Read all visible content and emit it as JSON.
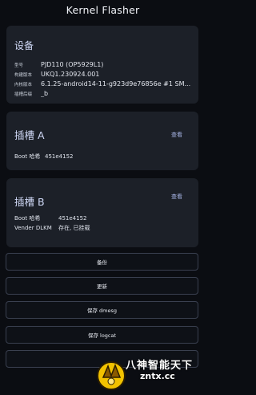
{
  "appbar": {
    "title": "Kernel Flasher"
  },
  "device": {
    "title": "设备",
    "rows": [
      {
        "label": "型号",
        "value": "PJD110 (OP5929L1)"
      },
      {
        "label": "构建版本",
        "value": "UKQ1.230924.001"
      },
      {
        "label": "内核版本",
        "value": "6.1.25-android14-11-g923d9e76856e #1 SM..."
      },
      {
        "label": "插槽后缀",
        "value": "_b"
      }
    ]
  },
  "slot_a": {
    "title": "插槽 A",
    "view_label": "查看",
    "rows": [
      {
        "label": "Boot 哈希",
        "value": "451e4152"
      }
    ]
  },
  "slot_b": {
    "title": "插槽 B",
    "view_label": "查看",
    "rows": [
      {
        "label": "Boot 哈希",
        "value": "451e4152"
      },
      {
        "label": "Vender DLKM",
        "value": "存在, 已挂载"
      }
    ]
  },
  "actions": [
    {
      "label": "备份"
    },
    {
      "label": "更新"
    },
    {
      "label": "保存 dmesg"
    },
    {
      "label": "保存 logcat"
    },
    {
      "label": ""
    }
  ],
  "watermark": {
    "line1": "八神智能天下",
    "line2": "zntx.cc"
  }
}
